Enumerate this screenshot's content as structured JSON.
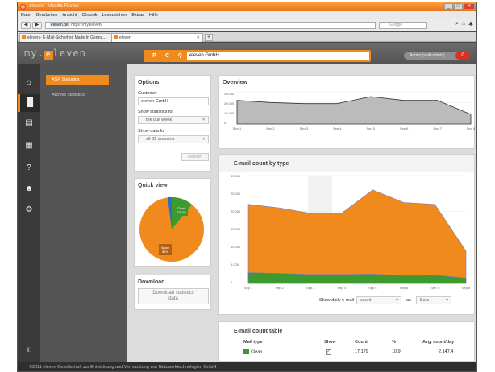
{
  "browser": {
    "title": "eleven - Mozilla Firefox",
    "menu": [
      "Datei",
      "Bearbeiten",
      "Ansicht",
      "Chronik",
      "Lesezeichen",
      "Extras",
      "Hilfe"
    ],
    "url_site": "eleven.de",
    "url": "https://my.eleven/",
    "search_placeholder": "Google",
    "tabs": [
      "eleven - E-Mail-Sicherheit Made In Germa...",
      "eleven"
    ]
  },
  "app": {
    "logo_pre": "my.",
    "logo_mid": "e",
    "logo_post": "leven",
    "search_buttons": [
      "P",
      "C"
    ],
    "search_value": "eleven GmbH",
    "user": "Admin (staff-admin)",
    "user_badge": "0"
  },
  "subnav": [
    "ASP Statistics",
    "Archive statistics"
  ],
  "options": {
    "title": "Options",
    "customer_label": "Customer",
    "customer_value": "eleven GmbH",
    "show_stats_label": "Show statistics for",
    "show_stats_value": "the last week",
    "show_data_label": "Show data for",
    "show_data_value": "all 39 domains",
    "refresh_label": "Refresh"
  },
  "quickview": {
    "title": "Quick view",
    "clean_label": "Clean",
    "clean_pct": "10.1%",
    "spam_label": "Spam",
    "spam_pct": "86%"
  },
  "download": {
    "title": "Download",
    "button_line1": "Download statistics",
    "button_line2": "data"
  },
  "overview": {
    "title": "Overview",
    "yticks": [
      "30.000",
      "20.000",
      "10.000",
      "0"
    ],
    "xticks": [
      "Sep 1",
      "Sep 2",
      "Sep 3",
      "Sep 4",
      "Sep 5",
      "Sep 6",
      "Sep 7",
      "Sep 8"
    ]
  },
  "emailcount": {
    "title": "E-mail count by type",
    "yticks": [
      "30.000",
      "25.000",
      "20.000",
      "15.000",
      "10.000",
      "5.000",
      "0"
    ],
    "xticks": [
      "Sep 1",
      "Sep 2",
      "Sep 3",
      "Sep 4",
      "Sep 5",
      "Sep 6",
      "Sep 7",
      "Sep 8"
    ],
    "show_label": "Show daily e-mail",
    "count_value": "count",
    "as_label": "as",
    "bars_value": "Bars"
  },
  "table": {
    "title": "E-mail count table",
    "headers": [
      "Mail type",
      "Show",
      "Count",
      "%",
      "Avg. count/day"
    ],
    "row": {
      "type": "Clean",
      "check": "✓",
      "count": "17.179",
      "pct": "10.9",
      "avg": "2.147.4"
    }
  },
  "chart_data": [
    {
      "type": "area",
      "title": "Overview",
      "x": [
        "Sep 1",
        "Sep 2",
        "Sep 3",
        "Sep 4",
        "Sep 5",
        "Sep 6",
        "Sep 7",
        "Sep 8"
      ],
      "series": [
        {
          "values": [
            22000,
            20000,
            19000,
            19000,
            25500,
            22000,
            22000,
            9000
          ]
        }
      ],
      "ylim": [
        0,
        30000
      ]
    },
    {
      "type": "area",
      "title": "E-mail count by type",
      "x": [
        "Sep 1",
        "Sep 2",
        "Sep 3",
        "Sep 4",
        "Sep 5",
        "Sep 6",
        "Sep 7",
        "Sep 8"
      ],
      "series": [
        {
          "values": [
            3000,
            2800,
            2500,
            2500,
            2600,
            2200,
            2300,
            1500
          ],
          "color": "#3c9a2f"
        },
        {
          "values": [
            22000,
            21000,
            19500,
            19500,
            26000,
            22500,
            22000,
            9000
          ],
          "color": "#f08a1c"
        }
      ],
      "ylim": [
        0,
        30000
      ]
    }
  ],
  "status": "©2011 eleven Gesellschaft zur Entwicklung und Vermarktung von Netzwerktechnologien GmbH",
  "colors": {
    "accent": "#f08a1c",
    "clean": "#3c9a2f",
    "dark": "#3a3a3a"
  }
}
